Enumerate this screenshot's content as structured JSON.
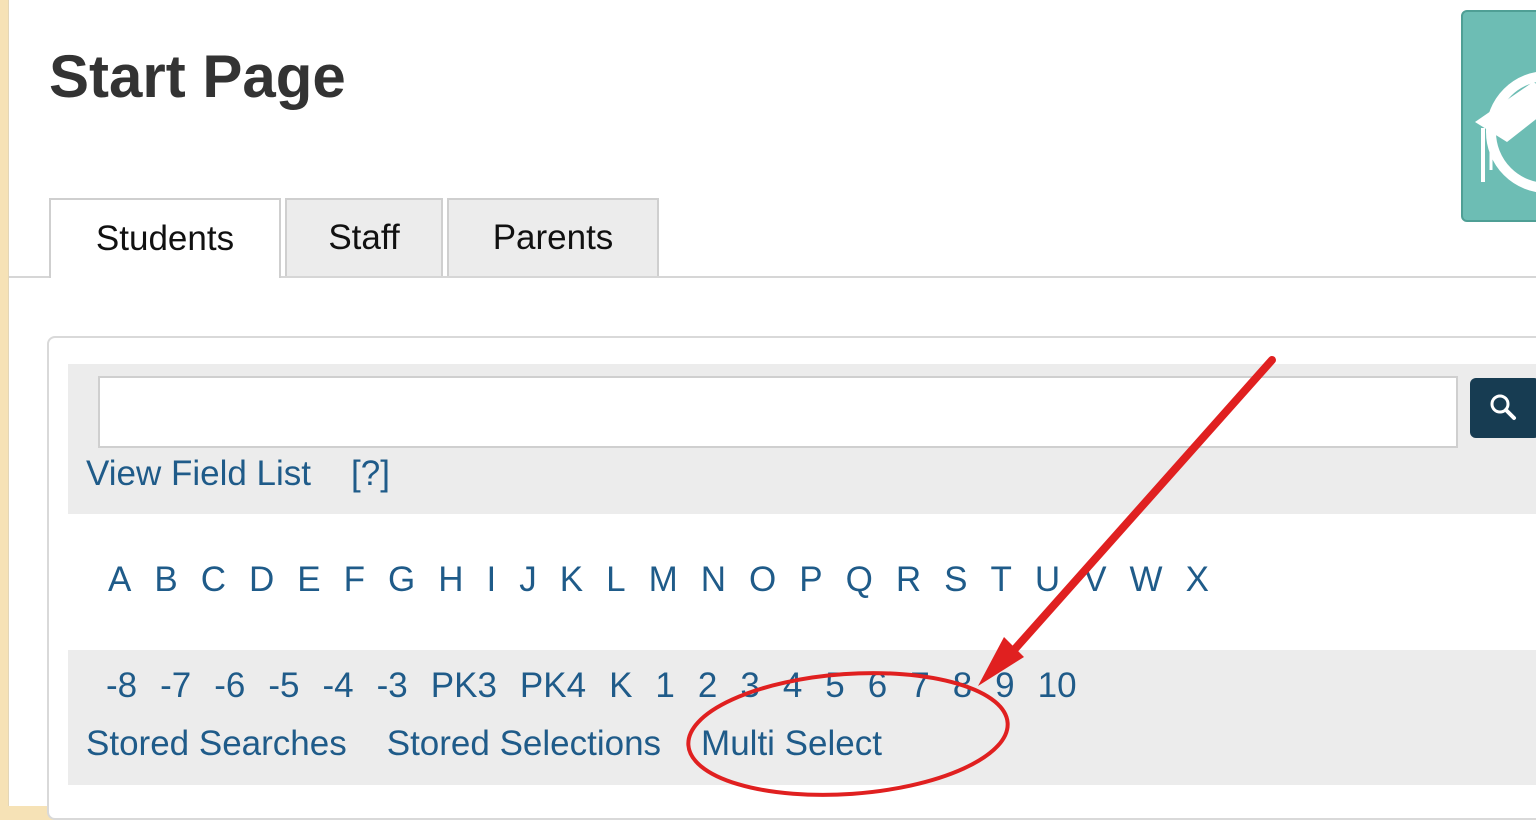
{
  "page": {
    "title": "Start Page"
  },
  "tabs": [
    {
      "label": "Students",
      "active": true
    },
    {
      "label": "Staff",
      "active": false
    },
    {
      "label": "Parents",
      "active": false
    }
  ],
  "search": {
    "value": "",
    "placeholder": "",
    "button_icon": "magnifier-icon"
  },
  "links": {
    "view_field_list": "View Field List",
    "help": "[?]"
  },
  "alphabet": [
    "A",
    "B",
    "C",
    "D",
    "E",
    "F",
    "G",
    "H",
    "I",
    "J",
    "K",
    "L",
    "M",
    "N",
    "O",
    "P",
    "Q",
    "R",
    "S",
    "T",
    "U",
    "V",
    "W",
    "X"
  ],
  "grades": [
    "-8",
    "-7",
    "-6",
    "-5",
    "-4",
    "-3",
    "PK3",
    "PK4",
    "K",
    "1",
    "2",
    "3",
    "4",
    "5",
    "6",
    "7",
    "8",
    "9",
    "10"
  ],
  "saved": {
    "stored_searches": "Stored Searches",
    "stored_selections": "Stored Selections",
    "multi_select": "Multi Select"
  },
  "colors": {
    "background": "#f6e2b6",
    "link": "#1f5b89",
    "search_button": "#173c52",
    "annotation": "#e02020",
    "logo": "#6dbdb4"
  }
}
